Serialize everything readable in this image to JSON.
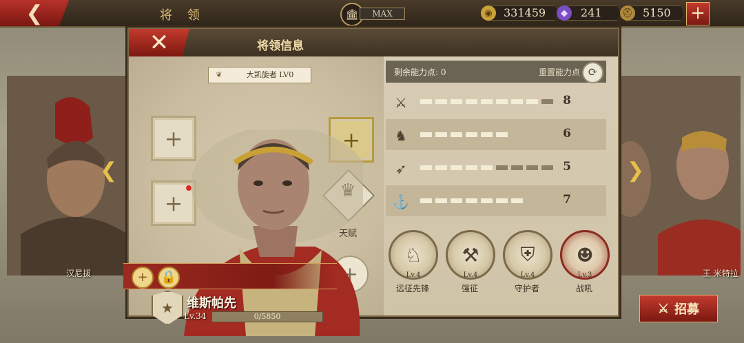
{
  "top_bar": {
    "title": "将 领",
    "max_label": "MAX",
    "resources": [
      {
        "icon": "coin-icon",
        "value": "331459",
        "color": "#c9a13a"
      },
      {
        "icon": "gem-icon",
        "value": "241",
        "color": "#7a4fc2"
      },
      {
        "icon": "helmet-icon",
        "value": "5150",
        "color": "#b08a3a"
      }
    ],
    "add_label": "+"
  },
  "panel": {
    "title": "将领信息",
    "close_label": "✕",
    "emblem_badge": "大凯旋者 LV0",
    "talent_label": "天赋",
    "hero": {
      "name": "维斯帕先",
      "level": "Lv.34",
      "xp": "0/5850"
    }
  },
  "points": {
    "remaining": "剩余能力点: 0",
    "reset_label": "重置能力点"
  },
  "stats": [
    {
      "icon": "sword-icon",
      "glyph": "⚔",
      "value": "8",
      "filled": 8,
      "total": 9
    },
    {
      "icon": "horse-icon",
      "glyph": "♞",
      "value": "6",
      "filled": 6,
      "total": 6
    },
    {
      "icon": "bow-icon",
      "glyph": "➶",
      "value": "5",
      "filled": 5,
      "total": 9
    },
    {
      "icon": "anchor-icon",
      "glyph": "⚓",
      "value": "7",
      "filled": 7,
      "total": 7
    }
  ],
  "skills": [
    {
      "name": "远征先锋",
      "level": "Lv.4",
      "glyph": "♘"
    },
    {
      "name": "强征",
      "level": "Lv.4",
      "glyph": "⚒"
    },
    {
      "name": "守护者",
      "level": "Lv.4",
      "glyph": "⛨"
    },
    {
      "name": "战吼",
      "level": "Lv.3",
      "glyph": "☻"
    }
  ],
  "side_heroes": {
    "left_name": "汉尼拔",
    "right_name": "王 米特拉"
  },
  "recruit_label": "招募",
  "colors": {
    "accent_red": "#a12a20",
    "gold": "#e6c24a",
    "panel": "#d3c7ad"
  }
}
